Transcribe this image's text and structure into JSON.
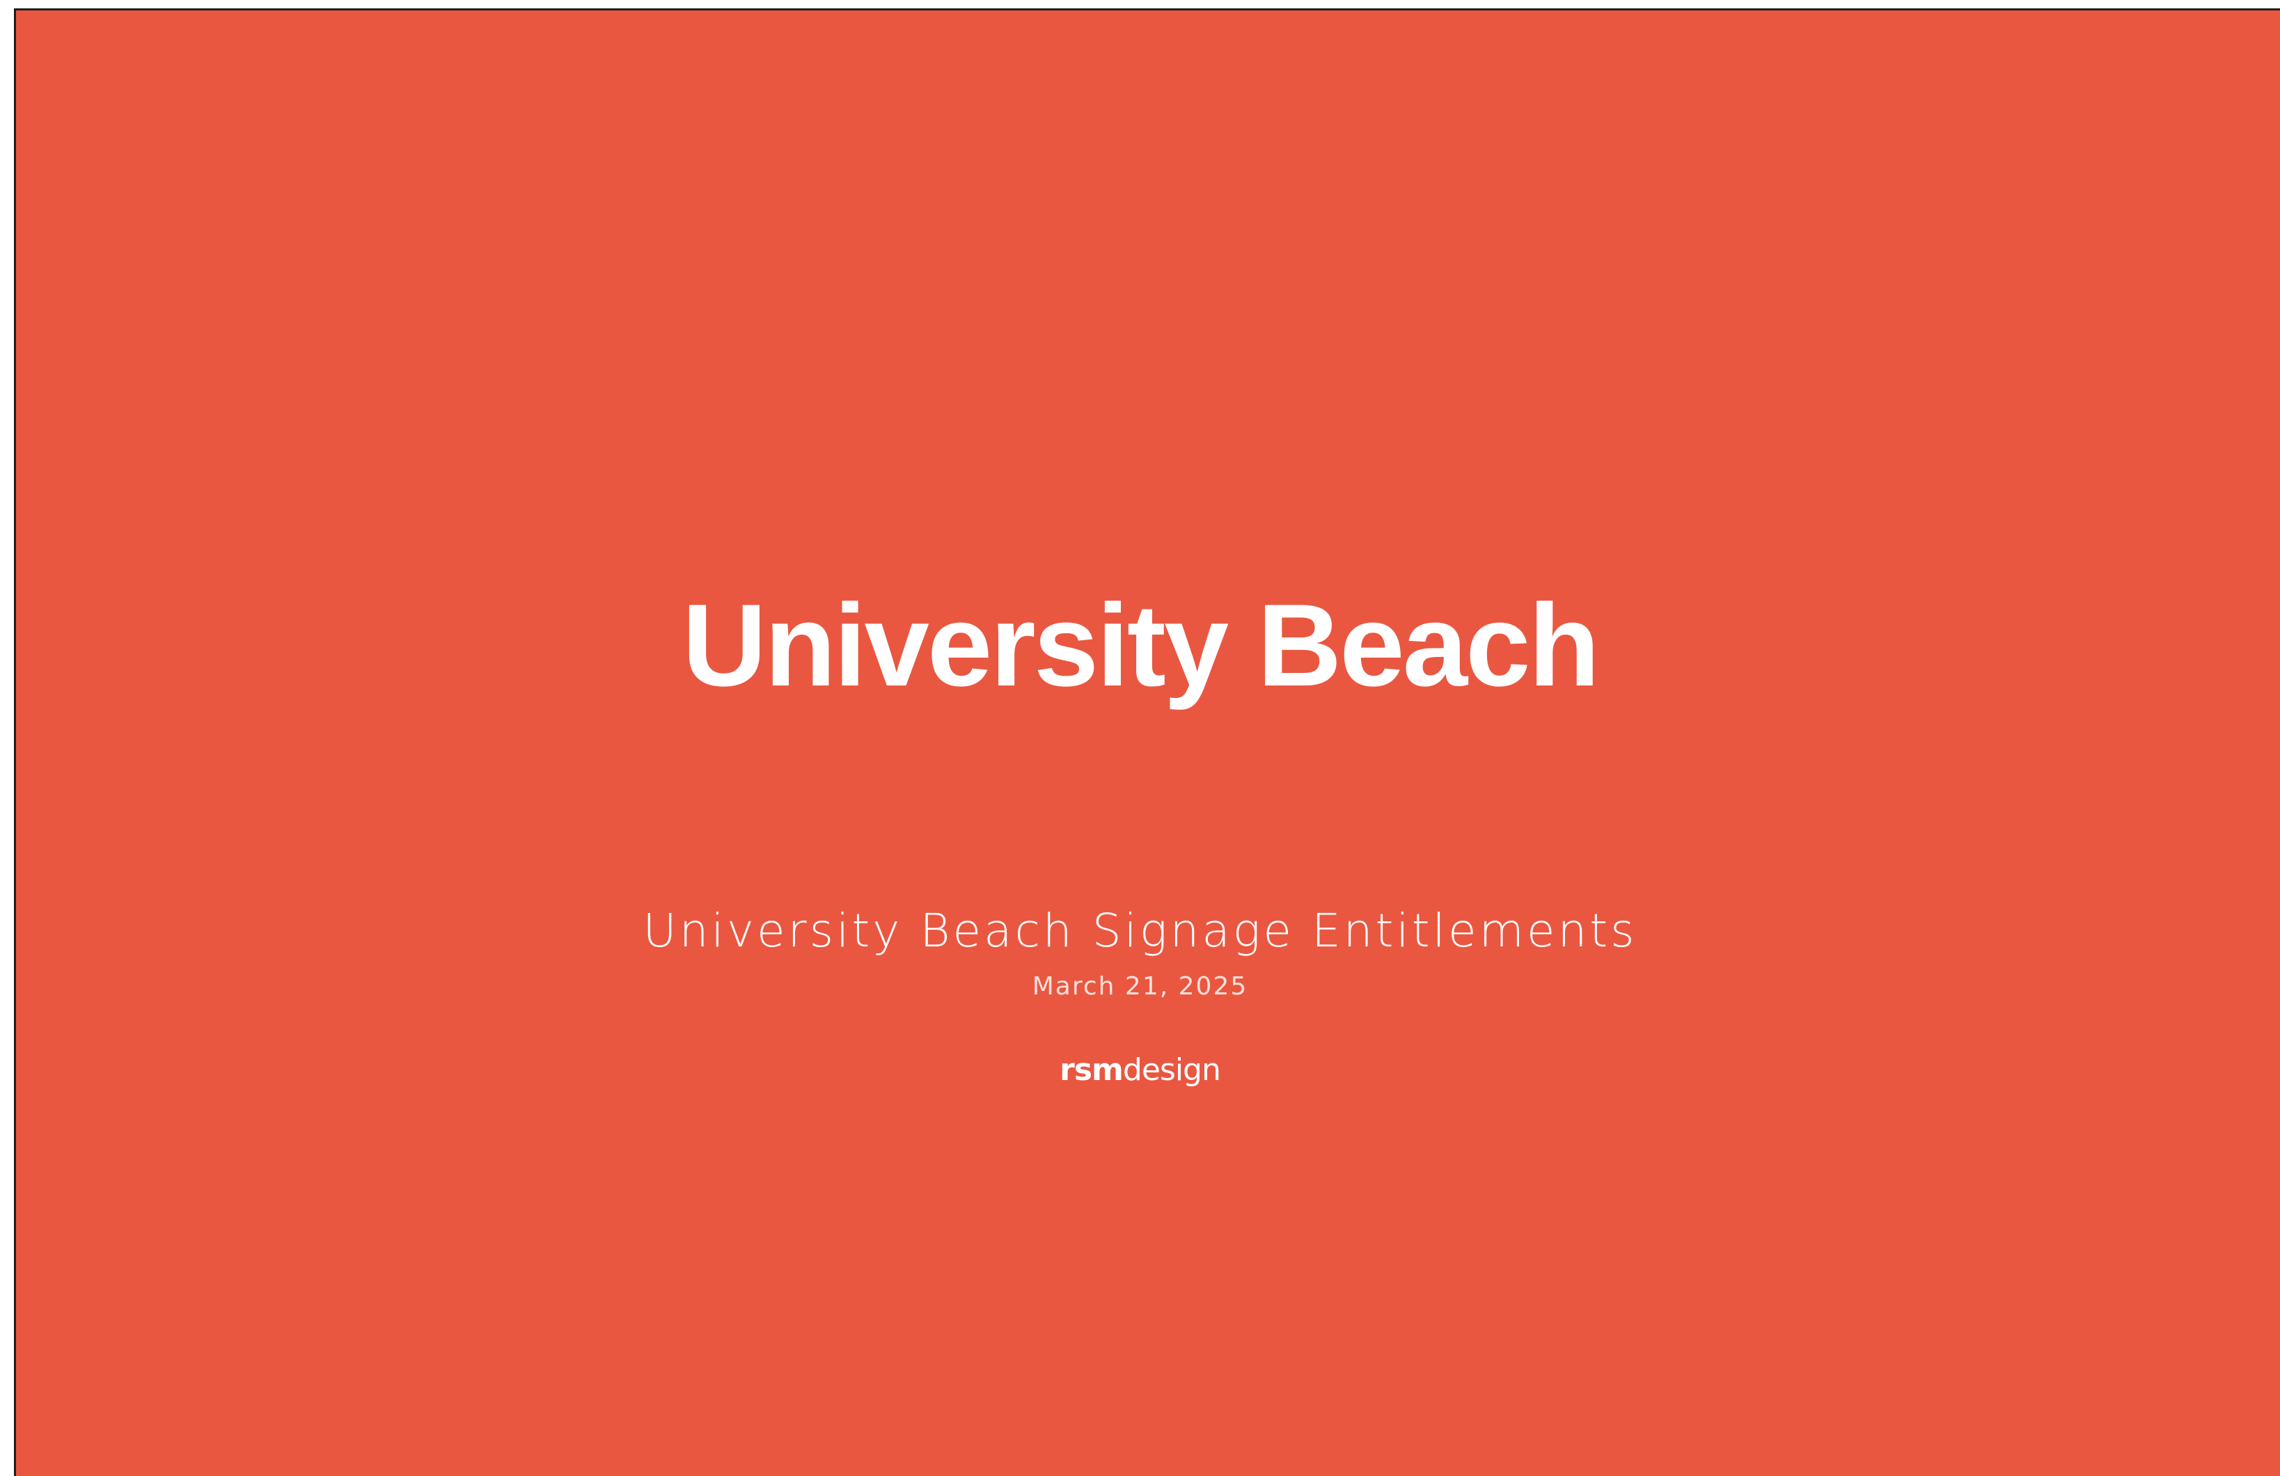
{
  "slide": {
    "title": "University Beach",
    "subtitle": "University Beach Signage Entitlements",
    "date": "March 21, 2025",
    "logo": {
      "bold": "rsm",
      "regular": "design"
    }
  },
  "colors": {
    "background": "#ea5741",
    "text": "#ffffff"
  }
}
